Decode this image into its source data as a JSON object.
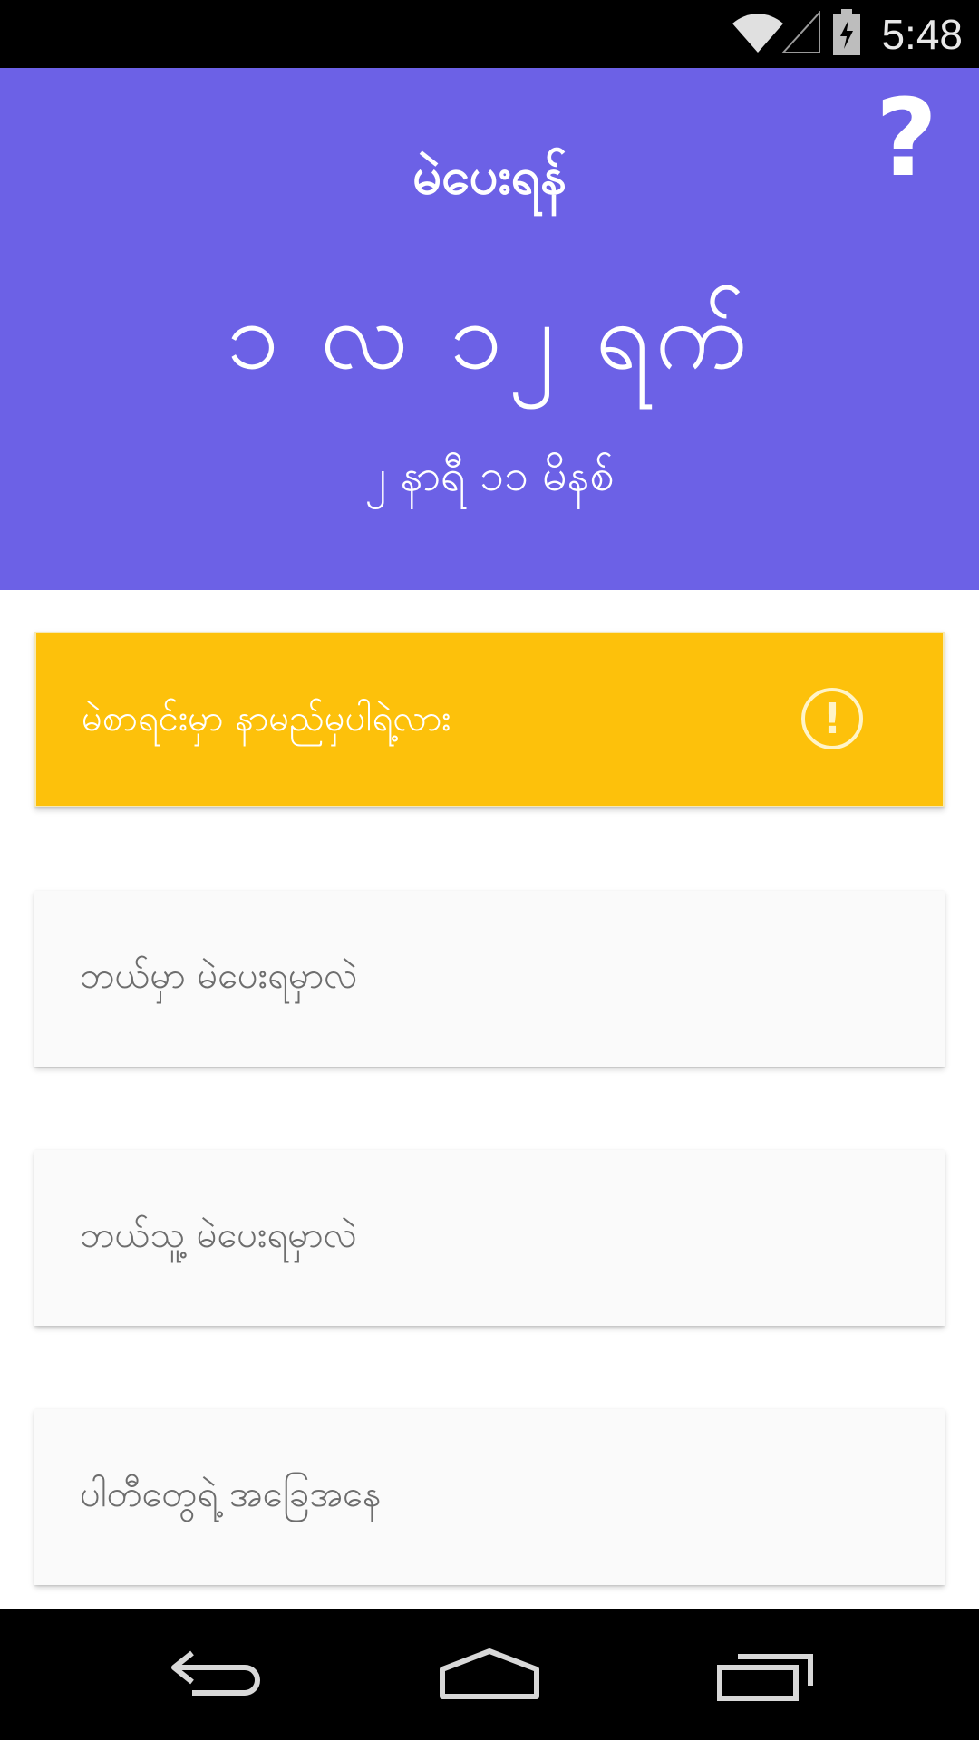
{
  "status_bar": {
    "time": "5:48",
    "icons": [
      "wifi-icon",
      "signal-icon",
      "battery-icon"
    ]
  },
  "header": {
    "title": "မဲပေးရန်",
    "countdown_days": "၁ လ ၁၂ ရက်",
    "countdown_time": "၂ နာရီ ၁၁ မိနစ်",
    "help_icon": "question-mark-icon",
    "background_color": "#6c61e6"
  },
  "cards": [
    {
      "label": "မဲစာရင်းမှာ နာမည်မှပါရဲ့လား",
      "style": "warning",
      "icon": "exclamation-circle-icon",
      "color": "#fdc10b"
    },
    {
      "label": "ဘယ်မှာ မဲပေးရမှာလဲ",
      "style": "default"
    },
    {
      "label": "ဘယ်သူ့ မဲပေးရမှာလဲ",
      "style": "default"
    },
    {
      "label": "ပါတီတွေရဲ့ အခြေအနေ",
      "style": "default"
    }
  ],
  "nav_bar": {
    "buttons": [
      "back-icon",
      "home-icon",
      "recent-apps-icon"
    ]
  }
}
